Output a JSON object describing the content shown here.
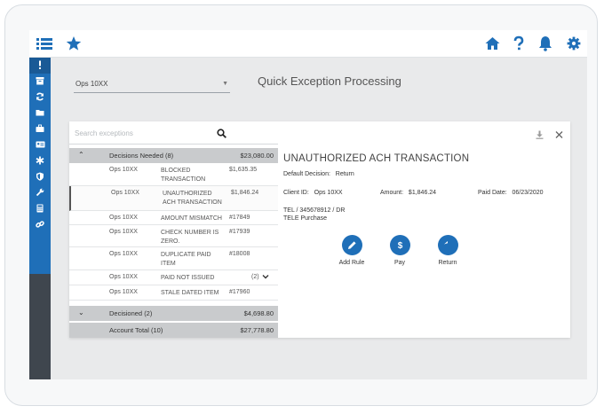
{
  "topbar": {
    "menu_icon": "list-icon",
    "favorite_icon": "star-icon",
    "home_icon": "home-icon",
    "help_icon": "question-icon",
    "notifications_icon": "bell-icon",
    "settings_icon": "gear-icon"
  },
  "sidebar": {
    "items": [
      {
        "icon": "exclamation-icon",
        "active": true
      },
      {
        "icon": "archive-box-icon"
      },
      {
        "icon": "refresh-icon"
      },
      {
        "icon": "folder-icon"
      },
      {
        "icon": "briefcase-icon"
      },
      {
        "icon": "id-card-icon"
      },
      {
        "icon": "asterisk-icon"
      },
      {
        "icon": "shield-icon"
      },
      {
        "icon": "wrench-icon"
      },
      {
        "icon": "calculator-icon"
      },
      {
        "icon": "link-icon"
      }
    ]
  },
  "account_select": {
    "value": "Ops 10XX"
  },
  "page": {
    "title": "Quick Exception Processing"
  },
  "search": {
    "placeholder": "Search exceptions"
  },
  "groups": {
    "needed": {
      "label": "Decisions Needed (8)",
      "amount": "$23,080.00"
    },
    "decisioned": {
      "label": "Decisioned (2)",
      "amount": "$4,698.80"
    },
    "total": {
      "label": "Account Total (10)",
      "amount": "$27,778.80"
    }
  },
  "rows": [
    {
      "account": "Ops 10XX",
      "reason": "BLOCKED TRANSACTION",
      "value": "$1,635.35"
    },
    {
      "account": "Ops 10XX",
      "reason": "UNAUTHORIZED ACH TRANSACTION",
      "value": "$1,846.24"
    },
    {
      "account": "Ops 10XX",
      "reason": "AMOUNT MISMATCH",
      "value": "#17849"
    },
    {
      "account": "Ops 10XX",
      "reason": "CHECK NUMBER IS ZERO.",
      "value": "#17939"
    },
    {
      "account": "Ops 10XX",
      "reason": "DUPLICATE PAID ITEM",
      "value": "#18008"
    },
    {
      "account": "Ops 10XX",
      "reason": "PAID NOT ISSUED",
      "value": "(2)"
    },
    {
      "account": "Ops 10XX",
      "reason": "STALE DATED ITEM",
      "value": "#17960"
    }
  ],
  "detail": {
    "title": "UNAUTHORIZED ACH TRANSACTION",
    "default_decision_label": "Default Decision:",
    "default_decision_value": "Return",
    "client_id_label": "Client ID:",
    "client_id_value": "Ops 10XX",
    "amount_label": "Amount:",
    "amount_value": "$1,846.24",
    "paid_date_label": "Paid Date:",
    "paid_date_value": "06/23/2020",
    "ref_line1": "TEL / 345678912 / DR",
    "ref_line2": "TELE Purchase"
  },
  "actions": [
    {
      "label": "Add Rule",
      "icon": "pencil-icon"
    },
    {
      "label": "Pay",
      "icon": "dollar-icon"
    },
    {
      "label": "Return",
      "icon": "reply-icon"
    }
  ],
  "colors": {
    "accent": "#1f6fb8",
    "sidebar_dark": "#3f464e",
    "group_bg": "#c9cbcd"
  }
}
